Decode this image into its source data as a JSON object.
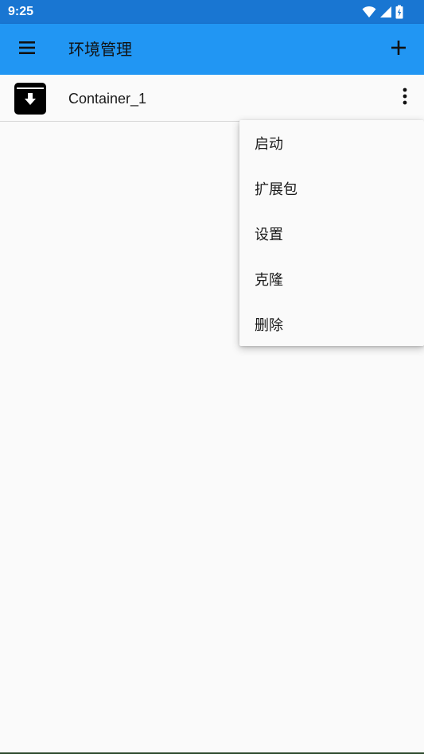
{
  "status_bar": {
    "time": "9:25",
    "icons": [
      "wifi-icon",
      "cell-signal-icon",
      "battery-charging-icon"
    ],
    "color": "#1976d2"
  },
  "app_bar": {
    "title": "环境管理",
    "menu_icon": "hamburger-menu-icon",
    "add_icon": "plus-icon",
    "color": "#2196f3"
  },
  "containers": [
    {
      "name": "Container_1",
      "icon": "archive-download-icon",
      "more_icon": "more-vert-icon"
    }
  ],
  "popup_menu": {
    "items": [
      {
        "label": "启动"
      },
      {
        "label": "扩展包"
      },
      {
        "label": "设置"
      },
      {
        "label": "克隆"
      },
      {
        "label": "删除"
      }
    ]
  }
}
